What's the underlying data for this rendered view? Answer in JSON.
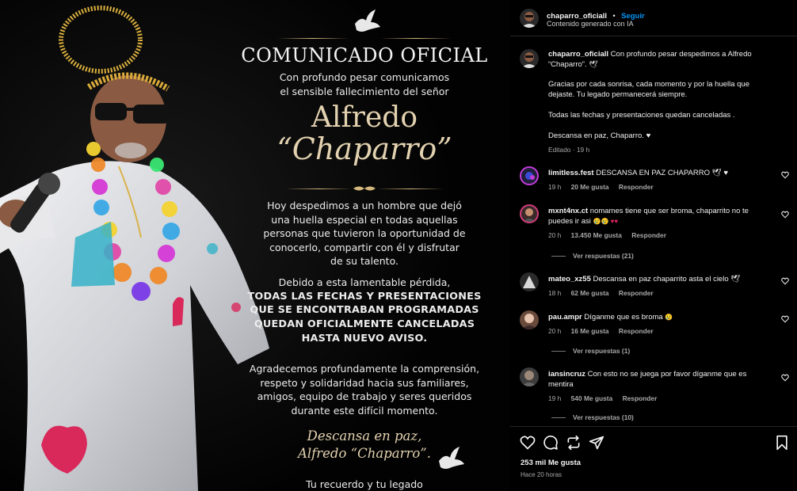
{
  "poster": {
    "title": "COMUNICADO OFICIAL",
    "intro": [
      "Con profundo pesar comunicamos",
      "el sensible fallecimiento del señor"
    ],
    "name_first": "Alfredo",
    "name_nick": "“Chaparro”",
    "para1": [
      "Hoy despedimos a un hombre que dejó",
      "una huella especial en todas aquellas",
      "personas que tuvieron la oportunidad de",
      "conocerlo, compartir con él y disfrutar",
      "de su talento."
    ],
    "para2_lead": "Debido a esta lamentable pérdida,",
    "para2_bold": [
      "TODAS LAS FECHAS Y PRESENTACIONES",
      "QUE SE ENCONTRABAN PROGRAMADAS",
      "QUEDAN OFICIALMENTE CANCELADAS",
      "HASTA NUEVO AVISO."
    ],
    "para3": [
      "Agradecemos profundamente la comprensión,",
      "respeto y solidaridad hacia sus familiares,",
      "amigos, equipo de trabajo y seres queridos",
      "durante este difícil momento."
    ],
    "farewell": [
      "Descansa en paz,",
      "Alfredo “Chaparro”."
    ],
    "footer": "Tu recuerdo y tu legado"
  },
  "header": {
    "username": "chaparro_oficiall",
    "dot": "•",
    "follow": "Seguir",
    "subtitle": "Contenido generado con IA"
  },
  "caption": {
    "username": "chaparro_oficiall",
    "line1": "Con profundo pesar despedimos a Alfredo",
    "line2": "“Chaparro”.",
    "para2": [
      "Gracias por cada sonrisa, cada momento y por la huella que",
      "dejaste. Tu legado permanecerá siempre."
    ],
    "para3": "Todas las fechas y presentaciones quedan canceladas .",
    "para4": "Descansa en paz, Chaparro.",
    "meta": "Editado · 19 h"
  },
  "comments": [
    {
      "username": "limitless.fest",
      "text": "DESCANSA EN PAZ CHAPARRO",
      "time": "19 h",
      "likes": "20 Me gusta",
      "reply": "Responder",
      "colors": [
        "#3a4bd6",
        "#c23bd8"
      ]
    },
    {
      "username": "mxnt4nx.ct",
      "text": "nomames tiene que ser broma, chaparrito no te",
      "text2": "puedes ir asi",
      "time": "20 h",
      "likes": "13.450 Me gusta",
      "reply": "Responder",
      "view_replies": "Ver respuestas (21)",
      "colors": [
        "#d13b7a",
        "#f0a23a"
      ]
    },
    {
      "username": "mateo_xz55",
      "text": "Descansa en paz chaparrito asta el cielo",
      "time": "18 h",
      "likes": "62 Me gusta",
      "reply": "Responder",
      "colors": [
        "#5a5a5a",
        "#cfcfcf"
      ]
    },
    {
      "username": "pau.ampr",
      "text": "Díganme que es broma",
      "time": "20 h",
      "likes": "16 Me gusta",
      "reply": "Responder",
      "view_replies": "Ver respuestas (1)",
      "colors": [
        "#7a5a4a",
        "#e6c3ae"
      ]
    },
    {
      "username": "iansincruz",
      "text": "Con esto no se juega por favor díganme que es",
      "text2": "mentira",
      "time": "19 h",
      "likes": "540 Me gusta",
      "reply": "Responder",
      "view_replies": "Ver respuestas (10)",
      "colors": [
        "#3d3d3d",
        "#9c8878"
      ]
    }
  ],
  "actions": {
    "likes": "253 mil Me gusta",
    "time": "Hace 20 horas"
  },
  "icons": [
    "heart-icon",
    "comment-icon",
    "repost-icon",
    "share-icon",
    "bookmark-icon",
    "dove-icon",
    "verified-icon"
  ],
  "colors": {
    "accent_blue": "#0095f6",
    "gold": "#d4b87d",
    "panel_bg": "#000000",
    "muted": "#a8a8a8"
  }
}
